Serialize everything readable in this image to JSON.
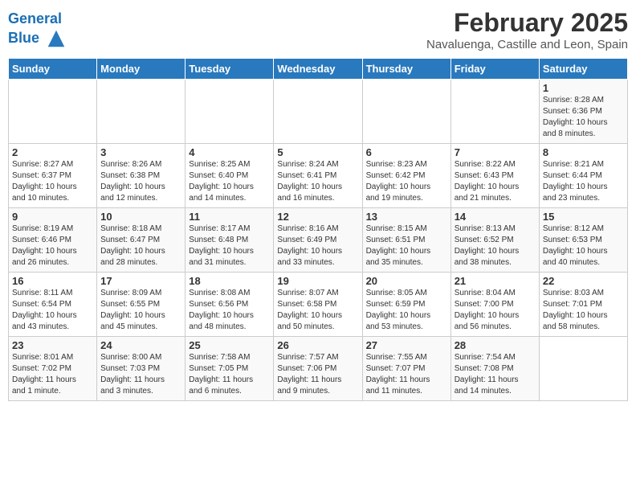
{
  "header": {
    "logo_line1": "General",
    "logo_line2": "Blue",
    "main_title": "February 2025",
    "sub_title": "Navaluenga, Castille and Leon, Spain"
  },
  "weekdays": [
    "Sunday",
    "Monday",
    "Tuesday",
    "Wednesday",
    "Thursday",
    "Friday",
    "Saturday"
  ],
  "weeks": [
    [
      {
        "day": "",
        "info": ""
      },
      {
        "day": "",
        "info": ""
      },
      {
        "day": "",
        "info": ""
      },
      {
        "day": "",
        "info": ""
      },
      {
        "day": "",
        "info": ""
      },
      {
        "day": "",
        "info": ""
      },
      {
        "day": "1",
        "info": "Sunrise: 8:28 AM\nSunset: 6:36 PM\nDaylight: 10 hours\nand 8 minutes."
      }
    ],
    [
      {
        "day": "2",
        "info": "Sunrise: 8:27 AM\nSunset: 6:37 PM\nDaylight: 10 hours\nand 10 minutes."
      },
      {
        "day": "3",
        "info": "Sunrise: 8:26 AM\nSunset: 6:38 PM\nDaylight: 10 hours\nand 12 minutes."
      },
      {
        "day": "4",
        "info": "Sunrise: 8:25 AM\nSunset: 6:40 PM\nDaylight: 10 hours\nand 14 minutes."
      },
      {
        "day": "5",
        "info": "Sunrise: 8:24 AM\nSunset: 6:41 PM\nDaylight: 10 hours\nand 16 minutes."
      },
      {
        "day": "6",
        "info": "Sunrise: 8:23 AM\nSunset: 6:42 PM\nDaylight: 10 hours\nand 19 minutes."
      },
      {
        "day": "7",
        "info": "Sunrise: 8:22 AM\nSunset: 6:43 PM\nDaylight: 10 hours\nand 21 minutes."
      },
      {
        "day": "8",
        "info": "Sunrise: 8:21 AM\nSunset: 6:44 PM\nDaylight: 10 hours\nand 23 minutes."
      }
    ],
    [
      {
        "day": "9",
        "info": "Sunrise: 8:19 AM\nSunset: 6:46 PM\nDaylight: 10 hours\nand 26 minutes."
      },
      {
        "day": "10",
        "info": "Sunrise: 8:18 AM\nSunset: 6:47 PM\nDaylight: 10 hours\nand 28 minutes."
      },
      {
        "day": "11",
        "info": "Sunrise: 8:17 AM\nSunset: 6:48 PM\nDaylight: 10 hours\nand 31 minutes."
      },
      {
        "day": "12",
        "info": "Sunrise: 8:16 AM\nSunset: 6:49 PM\nDaylight: 10 hours\nand 33 minutes."
      },
      {
        "day": "13",
        "info": "Sunrise: 8:15 AM\nSunset: 6:51 PM\nDaylight: 10 hours\nand 35 minutes."
      },
      {
        "day": "14",
        "info": "Sunrise: 8:13 AM\nSunset: 6:52 PM\nDaylight: 10 hours\nand 38 minutes."
      },
      {
        "day": "15",
        "info": "Sunrise: 8:12 AM\nSunset: 6:53 PM\nDaylight: 10 hours\nand 40 minutes."
      }
    ],
    [
      {
        "day": "16",
        "info": "Sunrise: 8:11 AM\nSunset: 6:54 PM\nDaylight: 10 hours\nand 43 minutes."
      },
      {
        "day": "17",
        "info": "Sunrise: 8:09 AM\nSunset: 6:55 PM\nDaylight: 10 hours\nand 45 minutes."
      },
      {
        "day": "18",
        "info": "Sunrise: 8:08 AM\nSunset: 6:56 PM\nDaylight: 10 hours\nand 48 minutes."
      },
      {
        "day": "19",
        "info": "Sunrise: 8:07 AM\nSunset: 6:58 PM\nDaylight: 10 hours\nand 50 minutes."
      },
      {
        "day": "20",
        "info": "Sunrise: 8:05 AM\nSunset: 6:59 PM\nDaylight: 10 hours\nand 53 minutes."
      },
      {
        "day": "21",
        "info": "Sunrise: 8:04 AM\nSunset: 7:00 PM\nDaylight: 10 hours\nand 56 minutes."
      },
      {
        "day": "22",
        "info": "Sunrise: 8:03 AM\nSunset: 7:01 PM\nDaylight: 10 hours\nand 58 minutes."
      }
    ],
    [
      {
        "day": "23",
        "info": "Sunrise: 8:01 AM\nSunset: 7:02 PM\nDaylight: 11 hours\nand 1 minute."
      },
      {
        "day": "24",
        "info": "Sunrise: 8:00 AM\nSunset: 7:03 PM\nDaylight: 11 hours\nand 3 minutes."
      },
      {
        "day": "25",
        "info": "Sunrise: 7:58 AM\nSunset: 7:05 PM\nDaylight: 11 hours\nand 6 minutes."
      },
      {
        "day": "26",
        "info": "Sunrise: 7:57 AM\nSunset: 7:06 PM\nDaylight: 11 hours\nand 9 minutes."
      },
      {
        "day": "27",
        "info": "Sunrise: 7:55 AM\nSunset: 7:07 PM\nDaylight: 11 hours\nand 11 minutes."
      },
      {
        "day": "28",
        "info": "Sunrise: 7:54 AM\nSunset: 7:08 PM\nDaylight: 11 hours\nand 14 minutes."
      },
      {
        "day": "",
        "info": ""
      }
    ]
  ]
}
